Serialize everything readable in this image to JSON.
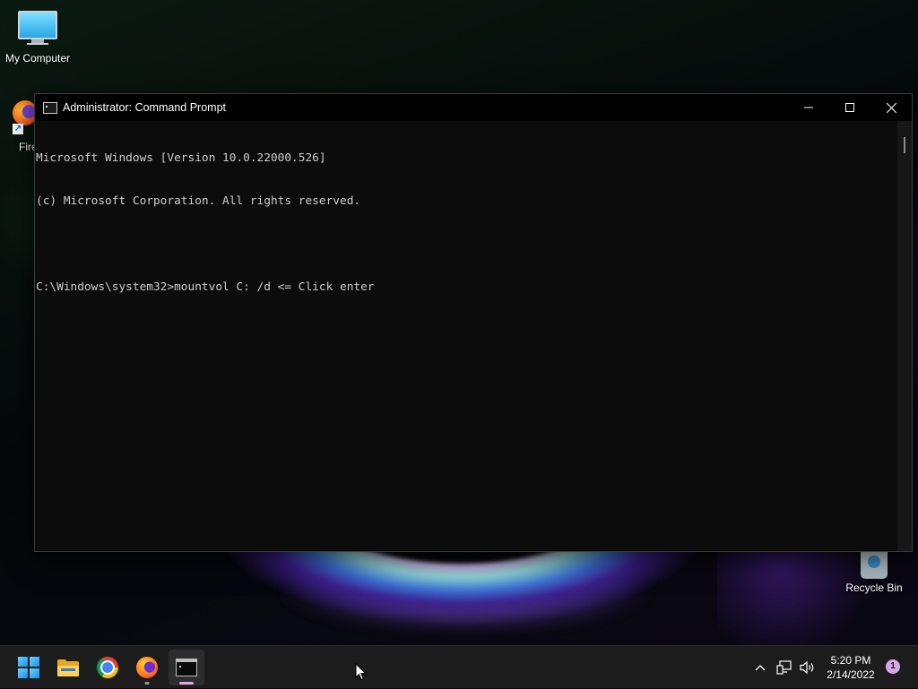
{
  "desktop": {
    "icons": [
      {
        "label": "My Computer",
        "icon": "computer-icon"
      },
      {
        "label": "Fire",
        "icon": "firefox-shortcut-icon"
      },
      {
        "label": "Recycle Bin",
        "icon": "recycle-bin-icon"
      }
    ]
  },
  "window": {
    "title": "Administrator: Command Prompt",
    "icon": "command-prompt-icon",
    "controls": {
      "minimize": "minimize-icon",
      "maximize": "maximize-icon",
      "close": "close-icon"
    },
    "console_lines": [
      "Microsoft Windows [Version 10.0.22000.526]",
      "(c) Microsoft Corporation. All rights reserved.",
      "",
      "C:\\Windows\\system32>mountvol C: /d <= Click enter"
    ]
  },
  "taskbar": {
    "apps": [
      {
        "name": "Start",
        "icon": "windows-start-icon"
      },
      {
        "name": "File Explorer",
        "icon": "folder-icon"
      },
      {
        "name": "Google Chrome",
        "icon": "chrome-icon"
      },
      {
        "name": "Firefox",
        "icon": "firefox-icon",
        "running": true
      },
      {
        "name": "Command Prompt",
        "icon": "terminal-icon",
        "running": true,
        "active": true
      }
    ],
    "tray": {
      "icons": [
        "chevron-up-icon",
        "network-icon",
        "speaker-icon"
      ],
      "time": "5:20 PM",
      "date": "2/14/2022",
      "notification_count": "1"
    }
  },
  "colors": {
    "console_bg": "#0c0c0c",
    "console_text": "#cccccc",
    "taskbar_bg": "#1c1c1c",
    "active_indicator": "#e6a8e0"
  }
}
